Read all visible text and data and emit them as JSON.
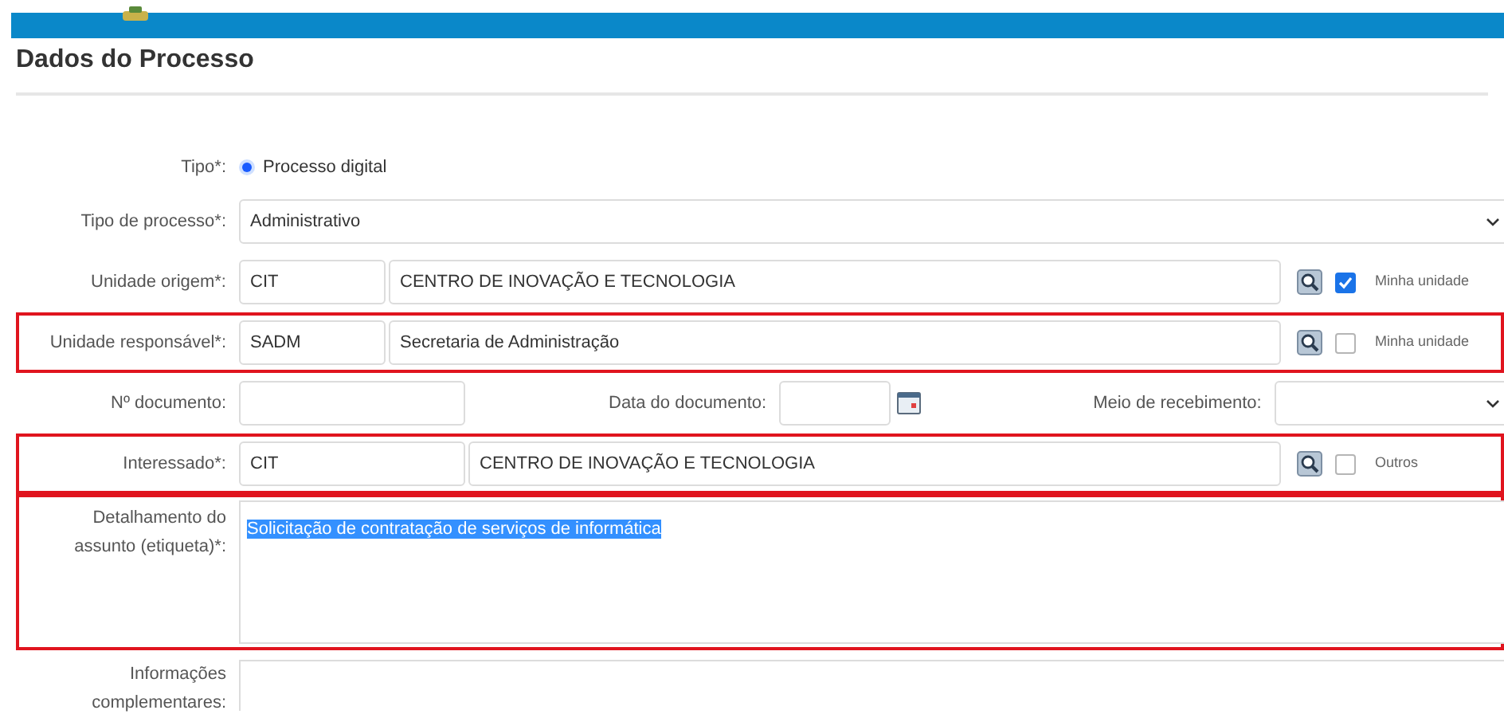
{
  "header": {
    "title": "Dados do Processo"
  },
  "form": {
    "rows": [
      {
        "kind": "radio",
        "label": "Tipo*:",
        "highlighted": false,
        "options": [
          {
            "label": "Processo digital",
            "selected": true
          }
        ]
      },
      {
        "kind": "select",
        "label": "Tipo de processo*:",
        "highlighted": false,
        "value": "Administrativo"
      },
      {
        "kind": "lookup",
        "label": "Unidade origem*:",
        "highlighted": false,
        "code": "CIT",
        "name": "CENTRO DE INOVAÇÃO E TECNOLOGIA",
        "wide_code": false,
        "check_label": "Minha unidade",
        "checked": true
      },
      {
        "kind": "lookup",
        "label": "Unidade responsável*:",
        "highlighted": true,
        "code": "SADM",
        "name": "Secretaria de Administração",
        "wide_code": false,
        "check_label": "Minha unidade",
        "checked": false
      },
      {
        "kind": "document",
        "label": "Nº documento:",
        "highlighted": false,
        "date_label": "Data do documento:",
        "method_label": "Meio de recebimento:"
      },
      {
        "kind": "lookup",
        "label": "Interessado*:",
        "highlighted": true,
        "code": "CIT",
        "name": "CENTRO DE INOVAÇÃO E TECNOLOGIA",
        "wide_code": true,
        "check_label": "Outros",
        "checked": false
      },
      {
        "kind": "textarea",
        "label": "Detalhamento do assunto (etiqueta)*:",
        "highlighted": true,
        "value": "Solicitação de contratação de serviços de informática",
        "text_selected": true
      },
      {
        "kind": "textarea_cut",
        "label": "Informações complementares:",
        "highlighted": false
      }
    ]
  }
}
